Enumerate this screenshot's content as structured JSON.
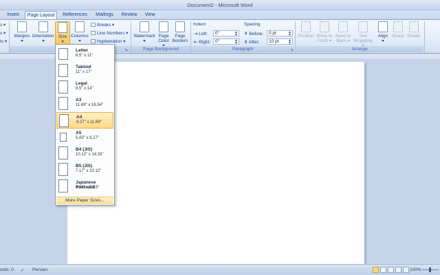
{
  "window": {
    "title": "Document2 - Microsoft Word"
  },
  "tabs": [
    {
      "label": "Insert"
    },
    {
      "label": "Page Layout",
      "active": true
    },
    {
      "label": "References"
    },
    {
      "label": "Mailings"
    },
    {
      "label": "Review"
    },
    {
      "label": "View"
    }
  ],
  "ribbon": {
    "page_setup": {
      "margins": "Margins",
      "orientation": "Orientation",
      "size": "Size",
      "columns": "Columns",
      "breaks": "Breaks",
      "line_numbers": "Line Numbers",
      "hyphenation": "Hyphenation"
    },
    "page_background": {
      "label": "Page Background",
      "watermark": "Watermark",
      "page_color_1": "Page",
      "page_color_2": "Color",
      "page_borders_1": "Page",
      "page_borders_2": "Borders"
    },
    "paragraph": {
      "label": "Paragraph",
      "indent": "Indent",
      "left_label": "Left:",
      "left_value": "0\"",
      "right_label": "Right:",
      "right_value": "0\"",
      "spacing": "Spacing",
      "before_label": "Before:",
      "before_value": "0 pt",
      "after_label": "After:",
      "after_value": "10 pt"
    },
    "arrange": {
      "label": "Arrange",
      "position": "Position",
      "bring_to_front_1": "Bring to",
      "bring_to_front_2": "Front",
      "send_to_back_1": "Send to",
      "send_to_back_2": "Back",
      "text_wrapping_1": "Text",
      "text_wrapping_2": "Wrapping",
      "align": "Align",
      "group": "Group",
      "rotate": "Rotate"
    }
  },
  "size_menu": {
    "items": [
      {
        "name": "Letter",
        "dims": "8.5\" x 11\""
      },
      {
        "name": "Tabloid",
        "dims": "11\" x 17\""
      },
      {
        "name": "Legal",
        "dims": "8.5\" x 14\""
      },
      {
        "name": "A3",
        "dims": "11.69\" x 16.54\""
      },
      {
        "name": "A4",
        "dims": "8.27\" x 11.69\"",
        "selected": true
      },
      {
        "name": "A5",
        "dims": "5.83\" x 8.27\""
      },
      {
        "name": "B4 (JIS)",
        "dims": "10.12\" x 14.33\""
      },
      {
        "name": "B5 (JIS)",
        "dims": "7.17\" x 10.12\""
      },
      {
        "name": "Japanese Postcard",
        "dims": "3.94\" x 5.83\""
      }
    ],
    "more": "More Paper Sizes..."
  },
  "status": {
    "words": "ords: 0",
    "language": "Persian",
    "zoom": "100%"
  }
}
